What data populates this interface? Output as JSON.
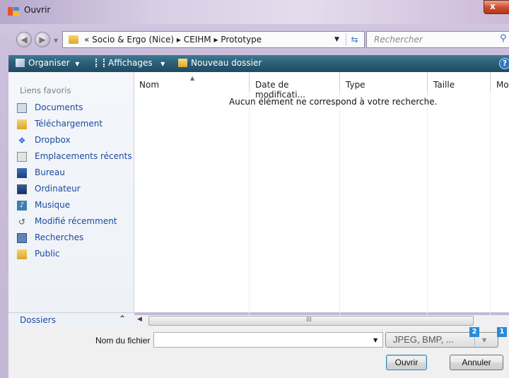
{
  "window": {
    "title": "Ouvrir",
    "close_label": "x"
  },
  "nav": {
    "back_icon": "back-arrow-icon",
    "forward_icon": "forward-arrow-icon",
    "address_path": "« Socio & Ergo (Nice) ▸ CEIHM ▸ Prototype",
    "search_placeholder": "Rechercher"
  },
  "toolbar": {
    "organise": "Organiser",
    "views": "Affichages",
    "new_folder": "Nouveau dossier",
    "help": "?"
  },
  "sidebar": {
    "header": "Liens favoris",
    "items": [
      {
        "label": "Documents",
        "icon": "documents-icon"
      },
      {
        "label": "Téléchargement",
        "icon": "folder-icon"
      },
      {
        "label": "Dropbox",
        "icon": "dropbox-icon"
      },
      {
        "label": "Emplacements récents",
        "icon": "recent-places-icon"
      },
      {
        "label": "Bureau",
        "icon": "desktop-icon"
      },
      {
        "label": "Ordinateur",
        "icon": "computer-icon"
      },
      {
        "label": "Musique",
        "icon": "music-icon"
      },
      {
        "label": "Modifié récemment",
        "icon": "recent-icon"
      },
      {
        "label": "Recherches",
        "icon": "search-folder-icon"
      },
      {
        "label": "Public",
        "icon": "folder-icon"
      }
    ],
    "folders_label": "Dossiers"
  },
  "files": {
    "columns": [
      "Nom",
      "Date de modificati...",
      "Type",
      "Taille",
      "Mot"
    ],
    "empty_message": "Aucun élément ne correspond à votre recherche."
  },
  "footer": {
    "filename_label": "Nom du fichier :",
    "filename_value": "",
    "filetype": "JPEG, BMP, ...",
    "open_label": "Ouvrir",
    "cancel_label": "Annuler",
    "badges": [
      "2",
      "1"
    ]
  },
  "scrollbar": {
    "grip": "III"
  }
}
